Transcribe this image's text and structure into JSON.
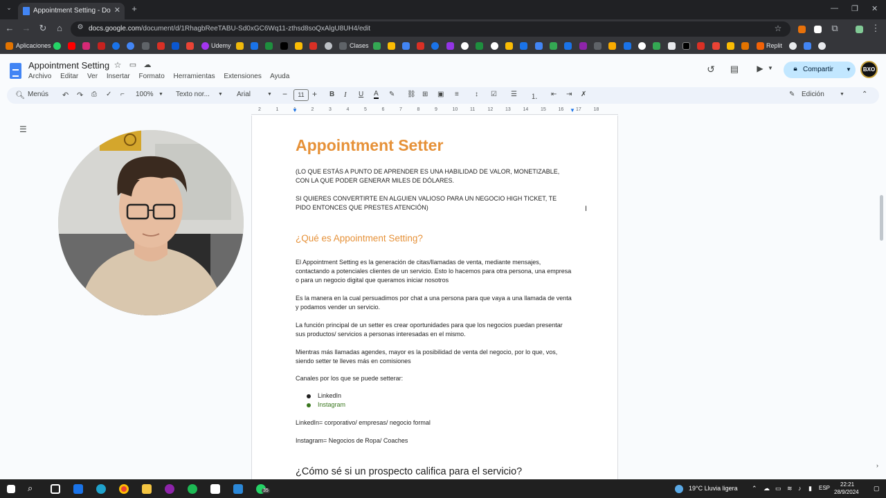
{
  "browser": {
    "tab_title": "Appointment Setting - Docum",
    "tab_close": "✕",
    "new_tab": "+",
    "url_domain": "docs.google.com",
    "url_path": "/document/d/1RhagbReeTABU-Sd0xGC6Wq11-zthsd8soQxAlgU8UH4/edit",
    "bookmarks": {
      "apps_label": "Aplicaciones",
      "udemy_label": "Udemy",
      "clases_label": "Clases",
      "replit_label": "Replit"
    }
  },
  "docs": {
    "title": "Appointment Setting",
    "menu": [
      "Archivo",
      "Editar",
      "Ver",
      "Insertar",
      "Formato",
      "Herramientas",
      "Extensiones",
      "Ayuda"
    ],
    "share_label": "Compartir",
    "avatar_text": "BXO"
  },
  "toolbar": {
    "search_label": "Menús",
    "zoom": "100%",
    "style": "Texto nor...",
    "font": "Arial",
    "font_size": "11",
    "mode": "Edición"
  },
  "ruler_ticks": [
    "2",
    "1",
    "1",
    "2",
    "3",
    "4",
    "5",
    "6",
    "7",
    "8",
    "9",
    "10",
    "11",
    "12",
    "13",
    "14",
    "15",
    "16",
    "17",
    "18"
  ],
  "document": {
    "heading": "Appointment Setter",
    "intro1": "(LO QUE ESTÁS A PUNTO DE APRENDER ES UNA HABILIDAD DE VALOR, MONETIZABLE, CON LA QUE PODER GENERAR MILES DE DÓLARES.",
    "intro2": "SI QUIERES CONVERTIRTE EN ALGUIEN VALIOSO PARA UN NEGOCIO HIGH TICKET, TE PIDO ENTONCES QUE PRESTES ATENCIÓN)",
    "h2_what": "¿Qué es Appointment Setting?",
    "p1": "El Appointment Setting es la generación de citas/llamadas de venta, mediante mensajes, contactando a potenciales clientes de un servicio. Esto lo hacemos para otra persona, una empresa o para un negocio digital que queramos iniciar nosotros",
    "p2": "Es la manera en la cual persuadimos por chat a una persona para que vaya a una llamada de venta y podamos vender un servicio.",
    "p3": "La función principal de un setter es crear oportunidades para que los negocios puedan presentar sus productos/ servicios a personas interesadas en el mismo.",
    "p4": "Mientras más llamadas agendes, mayor es la posibilidad de venta del negocio, por lo que, vos, siendo setter te lleves más en comisiones",
    "p5": "Canales por los que se puede setterar:",
    "list": [
      "LinkedIn",
      "Instagram"
    ],
    "p6": "LinkedIn= corporativo/ empresas/ negocio formal",
    "p7": "Instagram= Negocios de Ropa/ Coaches",
    "h2_how": "¿Cómo sé si un prospecto califica para el servicio?"
  },
  "taskbar": {
    "weather": "19°C  Lluvia ligera",
    "lang": "ESP",
    "time": "22:21",
    "date": "28/9/2024",
    "badge": "35"
  },
  "colors": {
    "accent_orange": "#e69138",
    "share_bg": "#c2e7ff",
    "chrome_dark": "#202124",
    "link_green": "#38761d"
  }
}
